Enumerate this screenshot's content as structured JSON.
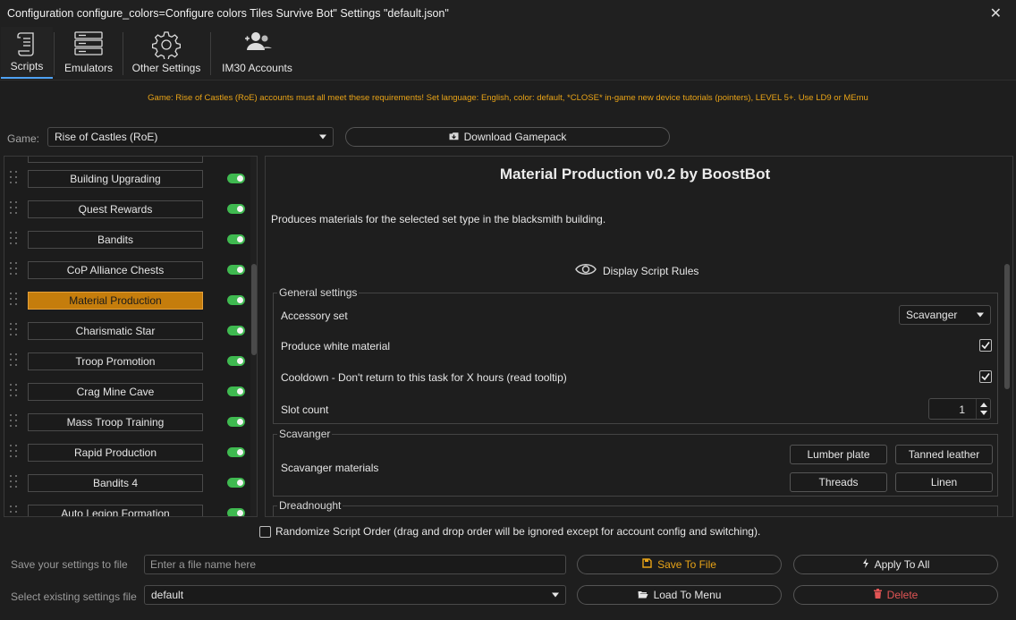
{
  "window": {
    "title": "Configuration configure_colors=Configure colors Tiles Survive Bot\" Settings \"default.json\""
  },
  "tabs": [
    {
      "label": "Scripts",
      "icon": "scroll-icon"
    },
    {
      "label": "Emulators",
      "icon": "server-icon"
    },
    {
      "label": "Other Settings",
      "icon": "gear-icon"
    },
    {
      "label": "IM30 Accounts",
      "icon": "users-icon"
    }
  ],
  "requirements": "Game: Rise of Castles (RoE) accounts must all meet these requirements! Set language: English, color: default, *CLOSE* in-game new device tutorials (pointers), LEVEL 5+. Use LD9 or MEmu",
  "game": {
    "label": "Game:",
    "selected": "Rise of Castles (RoE)",
    "download_label": "Download Gamepack"
  },
  "scripts": [
    {
      "label": "Building Upgrading",
      "enabled": true,
      "active": false
    },
    {
      "label": "Quest Rewards",
      "enabled": true,
      "active": false
    },
    {
      "label": "Bandits",
      "enabled": true,
      "active": false
    },
    {
      "label": "CoP Alliance Chests",
      "enabled": true,
      "active": false
    },
    {
      "label": "Material Production",
      "enabled": true,
      "active": true
    },
    {
      "label": "Charismatic Star",
      "enabled": true,
      "active": false
    },
    {
      "label": "Troop Promotion",
      "enabled": true,
      "active": false
    },
    {
      "label": "Crag Mine Cave",
      "enabled": true,
      "active": false
    },
    {
      "label": "Mass Troop Training",
      "enabled": true,
      "active": false
    },
    {
      "label": "Rapid Production",
      "enabled": true,
      "active": false
    },
    {
      "label": "Bandits 4",
      "enabled": true,
      "active": false
    },
    {
      "label": "Auto Legion Formation",
      "enabled": true,
      "active": false
    }
  ],
  "script_detail": {
    "title": "Material Production v0.2 by BoostBot",
    "description": "Produces materials for the selected set type in the blacksmith building.",
    "rules_label": "Display Script Rules",
    "general": {
      "title": "General settings",
      "accessory_label": "Accessory set",
      "accessory_value": "Scavanger",
      "white_label": "Produce white material",
      "white_checked": true,
      "cooldown_label": "Cooldown - Don't return to this task for X hours (read tooltip)",
      "cooldown_checked": true,
      "slot_label": "Slot count",
      "slot_value": "1"
    },
    "scavanger": {
      "title": "Scavanger",
      "materials_label": "Scavanger materials",
      "materials": [
        "Lumber plate",
        "Tanned leather",
        "Threads",
        "Linen"
      ]
    },
    "dreadnought": {
      "title": "Dreadnought"
    }
  },
  "randomize_label": "Randomize Script Order (drag and drop order will be ignored except for account config and switching).",
  "randomize_checked": false,
  "bottom": {
    "save_label": "Save your settings to file",
    "file_placeholder": "Enter a file name here",
    "save_button": "Save To File",
    "apply_button": "Apply To All",
    "select_label": "Select existing settings file",
    "selected_file": "default",
    "load_button": "Load To Menu",
    "delete_button": "Delete"
  },
  "colors": {
    "accent": "#4ea1f3",
    "warning_text": "#e8a317",
    "active_script": "#c57d0c",
    "toggle_on": "#3fb950",
    "delete": "#e25555"
  }
}
